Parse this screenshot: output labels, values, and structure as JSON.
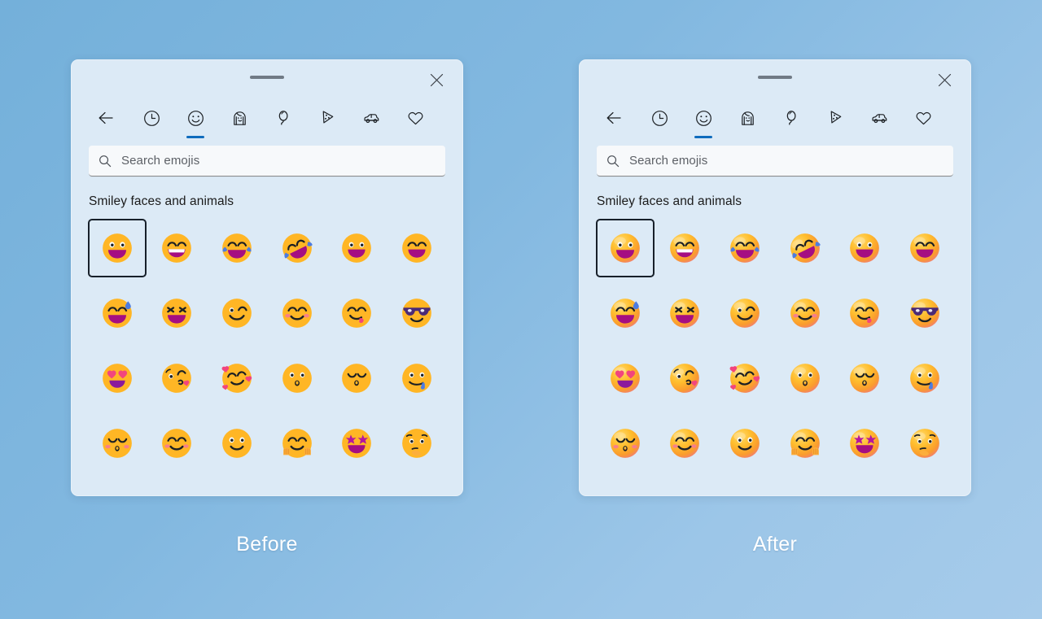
{
  "background": {
    "gradient_from": "#74b0da",
    "gradient_to": "#a6cbea"
  },
  "accent_color": "#0f6cbd",
  "panel_color": "#dceaf6",
  "selection_outline_color": "#17202a",
  "panels": [
    {
      "id": "before",
      "caption": "Before",
      "emoji_style": "flat",
      "titlebar": {
        "grab_handle_name": "drag-handle",
        "close_label": "Close"
      },
      "toolbar": {
        "back_label": "Back",
        "items": [
          {
            "icon": "clock-icon",
            "label": "Recently used",
            "selected": false
          },
          {
            "icon": "smiley-icon",
            "label": "Smiley faces and animals",
            "selected": true
          },
          {
            "icon": "person-icon",
            "label": "People",
            "selected": false
          },
          {
            "icon": "balloon-icon",
            "label": "Celebration and objects",
            "selected": false
          },
          {
            "icon": "pizza-icon",
            "label": "Food and plants",
            "selected": false
          },
          {
            "icon": "car-icon",
            "label": "Transportation and places",
            "selected": false
          },
          {
            "icon": "heart-icon",
            "label": "Symbols",
            "selected": false
          }
        ]
      },
      "search": {
        "icon": "search-icon",
        "placeholder": "Search emojis",
        "value": ""
      },
      "section_title": "Smiley faces and animals",
      "emojis": [
        {
          "name": "grinning-face-with-big-eyes",
          "selected": true
        },
        {
          "name": "beaming-face-with-smiling-eyes",
          "selected": false
        },
        {
          "name": "face-with-tears-of-joy",
          "selected": false
        },
        {
          "name": "rolling-on-the-floor-laughing",
          "selected": false
        },
        {
          "name": "grinning-face",
          "selected": false
        },
        {
          "name": "grinning-face-with-smiling-eyes",
          "selected": false
        },
        {
          "name": "grinning-face-with-sweat",
          "selected": false
        },
        {
          "name": "squinting-face-with-tongue",
          "selected": false
        },
        {
          "name": "winking-face",
          "selected": false
        },
        {
          "name": "smiling-face-with-smiling-eyes",
          "selected": false
        },
        {
          "name": "face-savoring-food",
          "selected": false
        },
        {
          "name": "smiling-face-with-sunglasses",
          "selected": false
        },
        {
          "name": "smiling-face-with-heart-eyes",
          "selected": false
        },
        {
          "name": "face-blowing-a-kiss",
          "selected": false
        },
        {
          "name": "smiling-face-with-hearts",
          "selected": false
        },
        {
          "name": "kissing-face",
          "selected": false
        },
        {
          "name": "kissing-face-with-closed-eyes",
          "selected": false
        },
        {
          "name": "drooling-face",
          "selected": false
        },
        {
          "name": "kissing-face-with-smiling-eyes",
          "selected": false
        },
        {
          "name": "smiling-face",
          "selected": false
        },
        {
          "name": "slightly-smiling-face",
          "selected": false
        },
        {
          "name": "hugging-face",
          "selected": false
        },
        {
          "name": "star-struck",
          "selected": false
        },
        {
          "name": "thinking-face",
          "selected": false
        }
      ]
    },
    {
      "id": "after",
      "caption": "After",
      "emoji_style": "three-d",
      "titlebar": {
        "grab_handle_name": "drag-handle",
        "close_label": "Close"
      },
      "toolbar": {
        "back_label": "Back",
        "items": [
          {
            "icon": "clock-icon",
            "label": "Recently used",
            "selected": false
          },
          {
            "icon": "smiley-icon",
            "label": "Smiley faces and animals",
            "selected": true
          },
          {
            "icon": "person-icon",
            "label": "People",
            "selected": false
          },
          {
            "icon": "balloon-icon",
            "label": "Celebration and objects",
            "selected": false
          },
          {
            "icon": "pizza-icon",
            "label": "Food and plants",
            "selected": false
          },
          {
            "icon": "car-icon",
            "label": "Transportation and places",
            "selected": false
          },
          {
            "icon": "heart-icon",
            "label": "Symbols",
            "selected": false
          }
        ]
      },
      "search": {
        "icon": "search-icon",
        "placeholder": "Search emojis",
        "value": ""
      },
      "section_title": "Smiley faces and animals",
      "emojis": [
        {
          "name": "grinning-face-with-big-eyes",
          "selected": true
        },
        {
          "name": "beaming-face-with-smiling-eyes",
          "selected": false
        },
        {
          "name": "face-with-tears-of-joy",
          "selected": false
        },
        {
          "name": "rolling-on-the-floor-laughing",
          "selected": false
        },
        {
          "name": "grinning-face",
          "selected": false
        },
        {
          "name": "grinning-face-with-smiling-eyes",
          "selected": false
        },
        {
          "name": "grinning-face-with-sweat",
          "selected": false
        },
        {
          "name": "squinting-face-with-tongue",
          "selected": false
        },
        {
          "name": "winking-face",
          "selected": false
        },
        {
          "name": "smiling-face-with-smiling-eyes",
          "selected": false
        },
        {
          "name": "face-savoring-food",
          "selected": false
        },
        {
          "name": "smiling-face-with-sunglasses",
          "selected": false
        },
        {
          "name": "smiling-face-with-heart-eyes",
          "selected": false
        },
        {
          "name": "face-blowing-a-kiss",
          "selected": false
        },
        {
          "name": "smiling-face-with-hearts",
          "selected": false
        },
        {
          "name": "kissing-face",
          "selected": false
        },
        {
          "name": "kissing-face-with-closed-eyes",
          "selected": false
        },
        {
          "name": "drooling-face",
          "selected": false
        },
        {
          "name": "kissing-face-with-smiling-eyes",
          "selected": false
        },
        {
          "name": "smiling-face",
          "selected": false
        },
        {
          "name": "slightly-smiling-face",
          "selected": false
        },
        {
          "name": "hugging-face",
          "selected": false
        },
        {
          "name": "star-struck",
          "selected": false
        },
        {
          "name": "thinking-face",
          "selected": false
        }
      ]
    }
  ]
}
